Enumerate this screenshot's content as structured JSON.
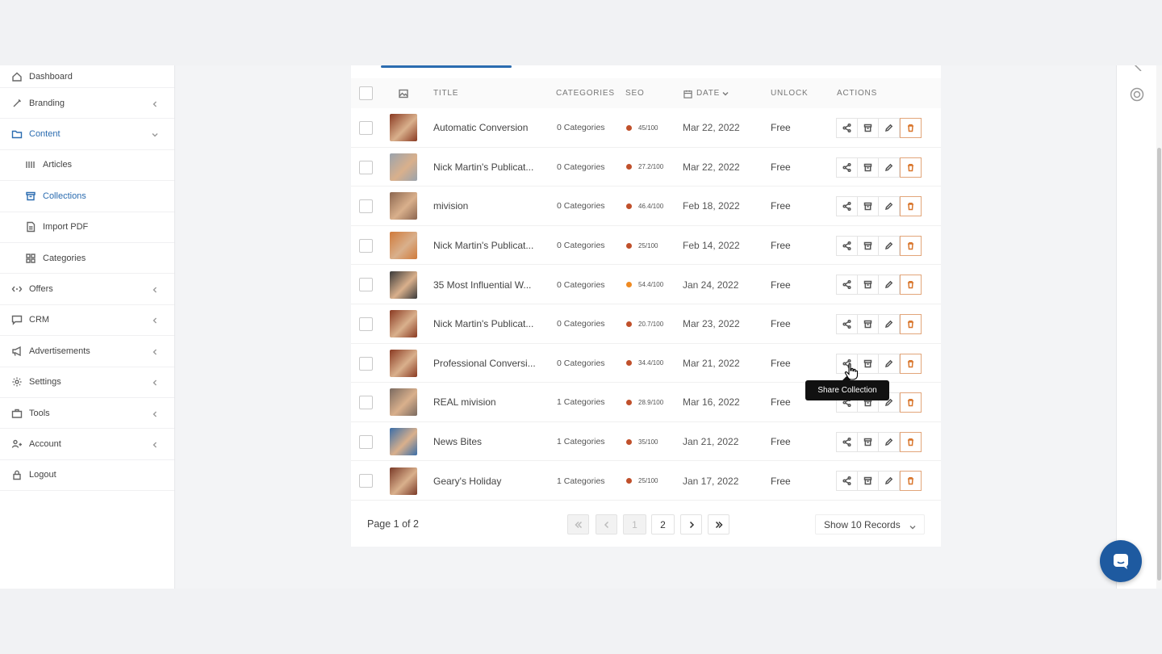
{
  "sidebar": {
    "items": [
      {
        "label": "Dashboard",
        "icon": "home-icon"
      },
      {
        "label": "Branding",
        "icon": "brush-icon"
      },
      {
        "label": "Content",
        "icon": "folder-icon"
      },
      {
        "label": "Articles",
        "icon": "articles-icon"
      },
      {
        "label": "Collections",
        "icon": "archive-icon"
      },
      {
        "label": "Import PDF",
        "icon": "pdf-icon"
      },
      {
        "label": "Categories",
        "icon": "grid-icon"
      },
      {
        "label": "Offers",
        "icon": "offers-icon"
      },
      {
        "label": "CRM",
        "icon": "chat-icon"
      },
      {
        "label": "Advertisements",
        "icon": "megaphone-icon"
      },
      {
        "label": "Settings",
        "icon": "gear-icon"
      },
      {
        "label": "Tools",
        "icon": "toolbox-icon"
      },
      {
        "label": "Account",
        "icon": "users-icon"
      },
      {
        "label": "Logout",
        "icon": "lock-icon"
      }
    ]
  },
  "table": {
    "headers": {
      "title": "TITLE",
      "categories": "CATEGORIES",
      "seo": "SEO",
      "date": "DATE",
      "unlock": "UNLOCK",
      "actions": "ACTIONS"
    },
    "rows": [
      {
        "title": "Automatic Conversion",
        "categories": "0 Categories",
        "seo": "45/100",
        "seo_color": "#c0502b",
        "date": "Mar 22, 2022",
        "unlock": "Free",
        "thumb_color": "#8a3a22"
      },
      {
        "title": "Nick Martin's Publicat...",
        "categories": "0 Categories",
        "seo": "27.2/100",
        "seo_color": "#c0502b",
        "date": "Mar 22, 2022",
        "unlock": "Free",
        "thumb_color": "#9aa3ad"
      },
      {
        "title": "mivision",
        "categories": "0 Categories",
        "seo": "46.4/100",
        "seo_color": "#c0502b",
        "date": "Feb 18, 2022",
        "unlock": "Free",
        "thumb_color": "#8c6650"
      },
      {
        "title": "Nick Martin's Publicat...",
        "categories": "0 Categories",
        "seo": "25/100",
        "seo_color": "#c0502b",
        "date": "Feb 14, 2022",
        "unlock": "Free",
        "thumb_color": "#d07a3a"
      },
      {
        "title": "35 Most Influential W...",
        "categories": "0 Categories",
        "seo": "54.4/100",
        "seo_color": "#ef8a22",
        "date": "Jan 24, 2022",
        "unlock": "Free",
        "thumb_color": "#3a3a3a"
      },
      {
        "title": "Nick Martin's Publicat...",
        "categories": "0 Categories",
        "seo": "20.7/100",
        "seo_color": "#c0502b",
        "date": "Mar 23, 2022",
        "unlock": "Free",
        "thumb_color": "#8a3a22"
      },
      {
        "title": "Professional Conversi...",
        "categories": "0 Categories",
        "seo": "34.4/100",
        "seo_color": "#c0502b",
        "date": "Mar 21, 2022",
        "unlock": "Free",
        "thumb_color": "#8a3a22"
      },
      {
        "title": "REAL mivision",
        "categories": "1 Categories",
        "seo": "28.9/100",
        "seo_color": "#c0502b",
        "date": "Mar 16, 2022",
        "unlock": "Free",
        "thumb_color": "#7a6a60"
      },
      {
        "title": "News Bites",
        "categories": "1 Categories",
        "seo": "35/100",
        "seo_color": "#c0502b",
        "date": "Jan 21, 2022",
        "unlock": "Free",
        "thumb_color": "#3a6ea8"
      },
      {
        "title": "Geary's Holiday",
        "categories": "1 Categories",
        "seo": "25/100",
        "seo_color": "#c0502b",
        "date": "Jan 17, 2022",
        "unlock": "Free",
        "thumb_color": "#7a3a28"
      }
    ]
  },
  "tooltip": {
    "text": "Share Collection"
  },
  "pagination": {
    "info": "Page 1 of 2",
    "pages": [
      "1",
      "2"
    ],
    "records_label": "Show 10 Records"
  },
  "colors": {
    "accent": "#2b6cb0",
    "delete": "#d9762c",
    "chat": "#1e5aa0"
  }
}
